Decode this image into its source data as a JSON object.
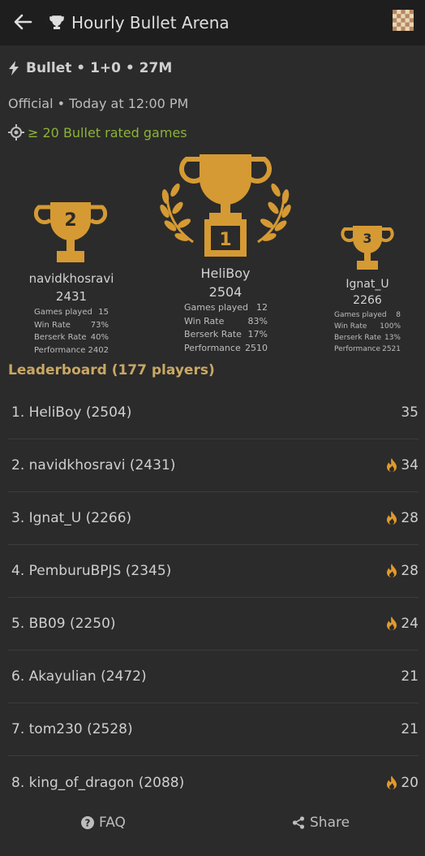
{
  "header": {
    "title": "Hourly Bullet Arena"
  },
  "tournament": {
    "format": "Bullet • 1+0 • 27M",
    "schedule": "Official • Today at 12:00 PM",
    "condition": "≥ 20 Bullet rated games"
  },
  "podium": {
    "stat_labels": [
      "Games played",
      "Win Rate",
      "Berserk Rate",
      "Performance"
    ],
    "first": {
      "rank": "1",
      "name": "HeliBoy",
      "rating": "2504",
      "stats": [
        "12",
        "83%",
        "17%",
        "2510"
      ]
    },
    "second": {
      "rank": "2",
      "name": "navidkhosravi",
      "rating": "2431",
      "stats": [
        "15",
        "73%",
        "40%",
        "2402"
      ]
    },
    "third": {
      "rank": "3",
      "name": "Ignat_U",
      "rating": "2266",
      "stats": [
        "8",
        "100%",
        "13%",
        "2521"
      ]
    }
  },
  "leaderboard": {
    "title": "Leaderboard (177 players)",
    "rows": [
      {
        "label": "1. HeliBoy (2504)",
        "score": "35",
        "fire": false
      },
      {
        "label": "2. navidkhosravi (2431)",
        "score": "34",
        "fire": true
      },
      {
        "label": "3. Ignat_U (2266)",
        "score": "28",
        "fire": true
      },
      {
        "label": "4. PemburuBPJS (2345)",
        "score": "28",
        "fire": true
      },
      {
        "label": "5. BB09 (2250)",
        "score": "24",
        "fire": true
      },
      {
        "label": "6. Akayulian (2472)",
        "score": "21",
        "fire": false
      },
      {
        "label": "7. tom230 (2528)",
        "score": "21",
        "fire": false
      },
      {
        "label": "8. king_of_dragon (2088)",
        "score": "20",
        "fire": true
      }
    ]
  },
  "footer": {
    "faq_label": "FAQ",
    "share_label": "Share"
  },
  "colors": {
    "accent_gold": "#c9a765",
    "trophy": "#d59a33",
    "condition_green": "#8bb335",
    "fire": "#e19a2a"
  }
}
